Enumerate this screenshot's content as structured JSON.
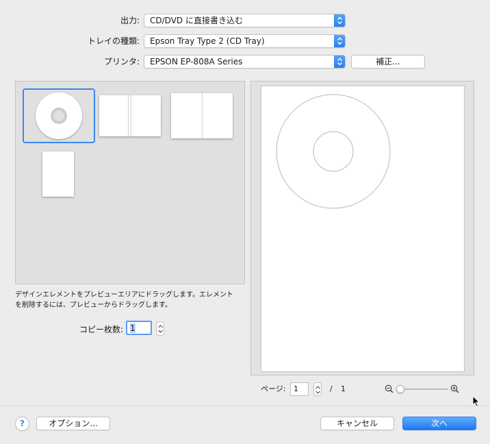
{
  "form": {
    "output_label": "出力:",
    "output_value": "CD/DVD に直接書き込む",
    "tray_label": "トレイの種類:",
    "tray_value": "Epson Tray Type 2 (CD Tray)",
    "printer_label": "プリンタ:",
    "printer_value": "EPSON EP-808A Series",
    "calibrate_label": "補正..."
  },
  "design_panel": {
    "elements": [
      "CDディスク",
      "ブックレット見開き",
      "ジャケット見開き",
      "カード"
    ],
    "instruction_line1": "デザインエレメントをプレビューエリアにドラッグします。エレメント",
    "instruction_line2": "を削除するには、プレビューからドラッグします。"
  },
  "copies": {
    "label": "コピー枚数:",
    "value": "1"
  },
  "preview": {
    "page_label": "ページ:",
    "page_value": "1",
    "separator": "/",
    "total_pages": "1",
    "zoom_level": 0.0
  },
  "footer": {
    "help": "?",
    "options_label": "オプション...",
    "cancel_label": "キャンセル",
    "next_label": "次へ"
  },
  "colors": {
    "accent": "#2a7ef0",
    "selection": "#3b86f0",
    "window_bg": "#ececec"
  }
}
